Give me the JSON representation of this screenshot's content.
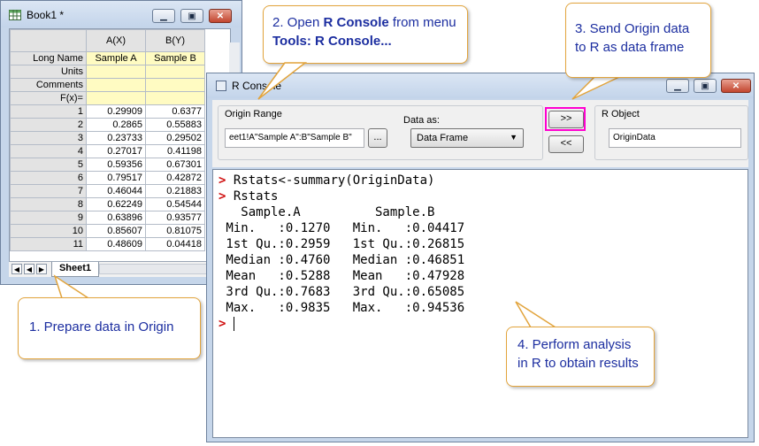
{
  "book": {
    "title": "Book1 *",
    "columns": [
      "A(X)",
      "B(Y)"
    ],
    "rows": [
      {
        "label": "Long Name",
        "a": "Sample A",
        "b": "Sample B"
      },
      {
        "label": "Units",
        "a": "",
        "b": ""
      },
      {
        "label": "Comments",
        "a": "",
        "b": ""
      },
      {
        "label": "F(x)=",
        "a": "",
        "b": ""
      },
      {
        "label": "1",
        "a": "0.29909",
        "b": "0.6377"
      },
      {
        "label": "2",
        "a": "0.2865",
        "b": "0.55883"
      },
      {
        "label": "3",
        "a": "0.23733",
        "b": "0.29502"
      },
      {
        "label": "4",
        "a": "0.27017",
        "b": "0.41198"
      },
      {
        "label": "5",
        "a": "0.59356",
        "b": "0.67301"
      },
      {
        "label": "6",
        "a": "0.79517",
        "b": "0.42872"
      },
      {
        "label": "7",
        "a": "0.46044",
        "b": "0.21883"
      },
      {
        "label": "8",
        "a": "0.62249",
        "b": "0.54544"
      },
      {
        "label": "9",
        "a": "0.63896",
        "b": "0.93577"
      },
      {
        "label": "10",
        "a": "0.85607",
        "b": "0.81075"
      },
      {
        "label": "11",
        "a": "0.48609",
        "b": "0.04418"
      }
    ],
    "sheet_tab": "Sheet1"
  },
  "console": {
    "title": "R Console",
    "origin_range_label": "Origin Range",
    "origin_range_value": "eet1!A\"Sample A\":B\"Sample B\"",
    "browse_label": "...",
    "data_as_label": "Data as:",
    "data_as_value": "Data Frame",
    "send_label": ">>",
    "receive_label": "<<",
    "r_object_label": "R Object",
    "r_object_value": "OriginData",
    "prompt": ">",
    "lines": [
      {
        "prompt": true,
        "text": "Rstats<-summary(OriginData)"
      },
      {
        "prompt": true,
        "text": "Rstats"
      },
      {
        "prompt": false,
        "text": "   Sample.A          Sample.B      "
      },
      {
        "prompt": false,
        "text": " Min.   :0.1270   Min.   :0.04417  "
      },
      {
        "prompt": false,
        "text": " 1st Qu.:0.2959   1st Qu.:0.26815  "
      },
      {
        "prompt": false,
        "text": " Median :0.4760   Median :0.46851  "
      },
      {
        "prompt": false,
        "text": " Mean   :0.5288   Mean   :0.47928  "
      },
      {
        "prompt": false,
        "text": " 3rd Qu.:0.7683   3rd Qu.:0.65085  "
      },
      {
        "prompt": false,
        "text": " Max.   :0.9835   Max.   :0.94536  "
      }
    ]
  },
  "callouts": {
    "step1": "1. Prepare data in Origin",
    "step2_pre": "2. Open ",
    "step2_bold1": "R Console",
    "step2_mid": " from menu ",
    "step2_bold2": "Tools: R Console...",
    "step3": "3. Send Origin data to R as data frame",
    "step4": "4. Perform analysis in R to obtain results"
  },
  "colors": {
    "callout_border": "#e2a43c",
    "callout_text": "#1c2ea0",
    "prompt": "#d01010",
    "highlight": "#ff00d0"
  }
}
